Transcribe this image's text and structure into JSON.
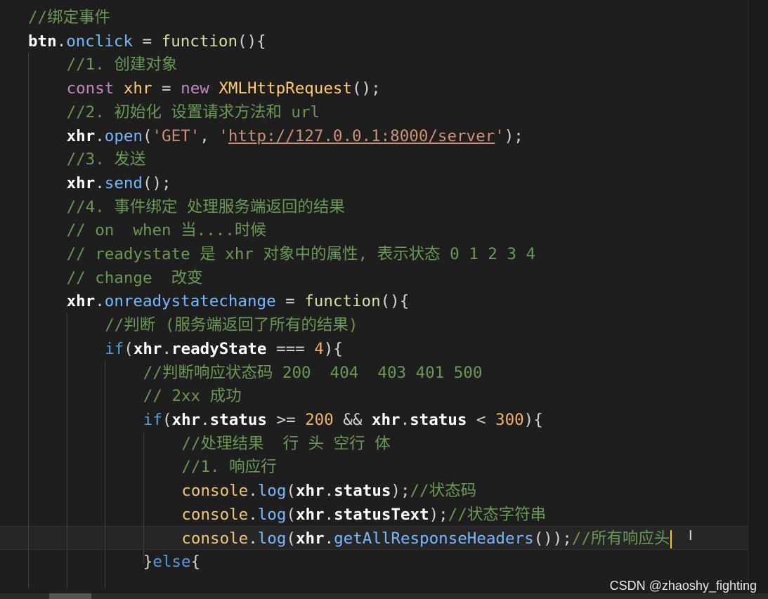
{
  "watermark": "CSDN @zhaoshy_fighting",
  "cursor_glyph": "I",
  "lines": [
    {
      "indent": 0,
      "tokens": [
        [
          "c-comment",
          "//绑定事件"
        ]
      ]
    },
    {
      "indent": 0,
      "tokens": [
        [
          "c-var",
          "btn"
        ],
        [
          "c-punc",
          "."
        ],
        [
          "c-prop",
          "onclick"
        ],
        [
          "c-punc",
          " = "
        ],
        [
          "c-fn",
          "function"
        ],
        [
          "c-punc",
          "(){"
        ]
      ]
    },
    {
      "indent": 1,
      "tokens": [
        [
          "c-comment",
          "//1. 创建对象"
        ]
      ]
    },
    {
      "indent": 1,
      "tokens": [
        [
          "c-kw",
          "const "
        ],
        [
          "c-cls",
          "xhr"
        ],
        [
          "c-punc",
          " = "
        ],
        [
          "c-kw",
          "new "
        ],
        [
          "c-cls",
          "XMLHttpRequest"
        ],
        [
          "c-punc",
          "();"
        ]
      ]
    },
    {
      "indent": 1,
      "tokens": [
        [
          "c-comment",
          "//2. 初始化 设置请求方法和 url"
        ]
      ]
    },
    {
      "indent": 1,
      "tokens": [
        [
          "c-var",
          "xhr"
        ],
        [
          "c-punc",
          "."
        ],
        [
          "c-prop",
          "open"
        ],
        [
          "c-punc",
          "("
        ],
        [
          "c-str",
          "'GET'"
        ],
        [
          "c-punc",
          ", "
        ],
        [
          "c-str",
          "'"
        ],
        [
          "c-url",
          "http://127.0.0.1:8000/server"
        ],
        [
          "c-str",
          "'"
        ],
        [
          "c-punc",
          ");"
        ]
      ]
    },
    {
      "indent": 1,
      "tokens": [
        [
          "c-comment",
          "//3. 发送"
        ]
      ]
    },
    {
      "indent": 1,
      "tokens": [
        [
          "c-var",
          "xhr"
        ],
        [
          "c-punc",
          "."
        ],
        [
          "c-prop",
          "send"
        ],
        [
          "c-punc",
          "();"
        ]
      ]
    },
    {
      "indent": 1,
      "tokens": [
        [
          "c-comment",
          "//4. 事件绑定 处理服务端返回的结果"
        ]
      ]
    },
    {
      "indent": 1,
      "tokens": [
        [
          "c-comment",
          "// on  when 当....时候"
        ]
      ]
    },
    {
      "indent": 1,
      "tokens": [
        [
          "c-comment",
          "// readystate 是 xhr 对象中的属性, 表示状态 0 1 2 3 4"
        ]
      ]
    },
    {
      "indent": 1,
      "tokens": [
        [
          "c-comment",
          "// change  改变"
        ]
      ]
    },
    {
      "indent": 1,
      "tokens": [
        [
          "c-var",
          "xhr"
        ],
        [
          "c-punc",
          "."
        ],
        [
          "c-prop",
          "onreadystatechange"
        ],
        [
          "c-punc",
          " = "
        ],
        [
          "c-fn",
          "function"
        ],
        [
          "c-punc",
          "(){"
        ]
      ]
    },
    {
      "indent": 2,
      "tokens": [
        [
          "c-comment",
          "//判断 (服务端返回了所有的结果)"
        ]
      ]
    },
    {
      "indent": 2,
      "tokens": [
        [
          "c-kw2",
          "if"
        ],
        [
          "c-punc",
          "("
        ],
        [
          "c-var",
          "xhr"
        ],
        [
          "c-punc",
          "."
        ],
        [
          "c-var",
          "readyState"
        ],
        [
          "c-punc",
          " === "
        ],
        [
          "c-num",
          "4"
        ],
        [
          "c-punc",
          "){"
        ]
      ]
    },
    {
      "indent": 3,
      "tokens": [
        [
          "c-comment",
          "//判断响应状态码 200  404  403 401 500"
        ]
      ]
    },
    {
      "indent": 3,
      "tokens": [
        [
          "c-comment",
          "// 2xx 成功"
        ]
      ]
    },
    {
      "indent": 3,
      "tokens": [
        [
          "c-kw2",
          "if"
        ],
        [
          "c-punc",
          "("
        ],
        [
          "c-var",
          "xhr"
        ],
        [
          "c-punc",
          "."
        ],
        [
          "c-var",
          "status"
        ],
        [
          "c-punc",
          " >= "
        ],
        [
          "c-num",
          "200"
        ],
        [
          "c-punc",
          " && "
        ],
        [
          "c-var",
          "xhr"
        ],
        [
          "c-punc",
          "."
        ],
        [
          "c-var",
          "status"
        ],
        [
          "c-punc",
          " < "
        ],
        [
          "c-num",
          "300"
        ],
        [
          "c-punc",
          "){"
        ]
      ]
    },
    {
      "indent": 4,
      "tokens": [
        [
          "c-comment",
          "//处理结果  行 头 空行 体"
        ]
      ]
    },
    {
      "indent": 4,
      "tokens": [
        [
          "c-comment",
          "//1. 响应行"
        ]
      ]
    },
    {
      "indent": 4,
      "tokens": [
        [
          "c-obj",
          "console"
        ],
        [
          "c-punc",
          "."
        ],
        [
          "c-prop",
          "log"
        ],
        [
          "c-punc",
          "("
        ],
        [
          "c-var",
          "xhr"
        ],
        [
          "c-punc",
          "."
        ],
        [
          "c-var",
          "status"
        ],
        [
          "c-punc",
          ");"
        ],
        [
          "c-comment",
          "//状态码"
        ]
      ]
    },
    {
      "indent": 4,
      "tokens": [
        [
          "c-obj",
          "console"
        ],
        [
          "c-punc",
          "."
        ],
        [
          "c-prop",
          "log"
        ],
        [
          "c-punc",
          "("
        ],
        [
          "c-var",
          "xhr"
        ],
        [
          "c-punc",
          "."
        ],
        [
          "c-var",
          "statusText"
        ],
        [
          "c-punc",
          ");"
        ],
        [
          "c-comment",
          "//状态字符串"
        ]
      ]
    },
    {
      "indent": 4,
      "current": true,
      "tokens": [
        [
          "c-obj",
          "console"
        ],
        [
          "c-punc",
          "."
        ],
        [
          "c-prop",
          "log"
        ],
        [
          "c-punc",
          "("
        ],
        [
          "c-var",
          "xhr"
        ],
        [
          "c-punc",
          "."
        ],
        [
          "c-prop",
          "getAllResponseHeaders"
        ],
        [
          "c-punc",
          "());"
        ],
        [
          "c-comment",
          "//所有响应头"
        ]
      ]
    },
    {
      "indent": 3,
      "tokens": [
        [
          "c-punc",
          "}"
        ],
        [
          "c-kw2",
          "else"
        ],
        [
          "c-punc",
          "{"
        ]
      ]
    }
  ]
}
